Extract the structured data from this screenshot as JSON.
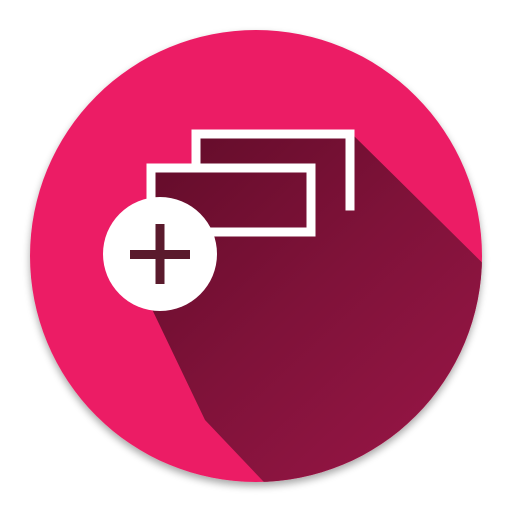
{
  "icon": {
    "name": "add-tab-icon",
    "colors": {
      "circle": "#ec1f65",
      "shadow_dark": "#5e0b27",
      "shadow_mid": "#7f1239",
      "shadow_light": "#a0174a",
      "outline": "#ffffff",
      "plus_badge": "#ffffff",
      "plus_sign": "#5a1a2c"
    }
  }
}
